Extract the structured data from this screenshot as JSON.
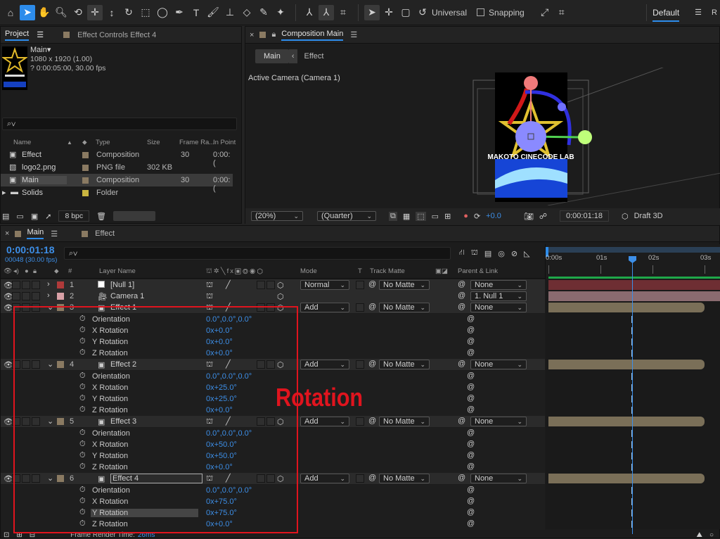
{
  "toolbar": {
    "universal_label": "Universal",
    "snapping_label": "Snapping",
    "workspace": "Default",
    "workspace_more": "R"
  },
  "project": {
    "tab_project": "Project",
    "tab_effect_controls": "Effect Controls Effect 4",
    "comp_name": "Main▾",
    "comp_size": "1080 x 1920 (1.00)",
    "comp_duration": "? 0:00:05:00, 30.00 fps",
    "search_placeholder": "⌕∨",
    "columns": {
      "name": "Name",
      "type": "Type",
      "size": "Size",
      "frame_rate": "Frame Ra...",
      "in_point": "In Point"
    },
    "items": [
      {
        "name": "Effect",
        "type": "Composition",
        "size": "",
        "frame_rate": "30",
        "in_point": "0:00:("
      },
      {
        "name": "logo2.png",
        "type": "PNG file",
        "size": "302 KB",
        "frame_rate": "",
        "in_point": ""
      },
      {
        "name": "Main",
        "type": "Composition",
        "size": "",
        "frame_rate": "30",
        "in_point": "0:00:("
      },
      {
        "name": "Solids",
        "type": "Folder",
        "size": "",
        "frame_rate": "",
        "in_point": ""
      }
    ],
    "bpc": "8 bpc"
  },
  "composition": {
    "tab": "Composition Main",
    "crumb_main": "Main",
    "crumb_effect": "Effect",
    "camera_label": "Active Camera (Camera 1)",
    "logo_text": "MAKOTO CINECODE LAB",
    "zoom": "(20%)",
    "resolution": "(Quarter)",
    "exposure": "+0.0",
    "timecode": "0:00:01:18",
    "renderer": "Draft 3D"
  },
  "timeline": {
    "tab_main": "Main",
    "tab_effect": "Effect",
    "timecode": "0:00:01:18",
    "frame_info": "00048 (30.00 fps)",
    "search_placeholder": "⌕∨",
    "columns": {
      "num": "#",
      "layer_name": "Layer Name",
      "mode": "Mode",
      "t": "T",
      "track_matte": "Track Matte",
      "parent": "Parent & Link"
    },
    "ruler": [
      "0:00s",
      "01s",
      "02s",
      "03s"
    ],
    "render_time": "Frame Render Time:",
    "render_value": "26ms",
    "layers": [
      {
        "num": "1",
        "name": "[Null 1]",
        "mode": "Normal",
        "matte": "No Matte",
        "parent": "None",
        "color": "#b03a3a"
      },
      {
        "num": "2",
        "name": "Camera 1",
        "mode": "",
        "matte": "",
        "parent": "1. Null 1",
        "color": "#d9a1a7"
      },
      {
        "num": "3",
        "name": "Effect 1",
        "mode": "Add",
        "matte": "No Matte",
        "parent": "None",
        "color": "#8a7a62",
        "props": [
          {
            "name": "Orientation",
            "value": "0.0°,0.0°,0.0°"
          },
          {
            "name": "X Rotation",
            "value": "0x+0.0°"
          },
          {
            "name": "Y Rotation",
            "value": "0x+0.0°"
          },
          {
            "name": "Z Rotation",
            "value": "0x+0.0°"
          }
        ]
      },
      {
        "num": "4",
        "name": "Effect 2",
        "mode": "Add",
        "matte": "No Matte",
        "parent": "None",
        "color": "#8a7a62",
        "props": [
          {
            "name": "Orientation",
            "value": "0.0°,0.0°,0.0°"
          },
          {
            "name": "X Rotation",
            "value": "0x+25.0°"
          },
          {
            "name": "Y Rotation",
            "value": "0x+25.0°"
          },
          {
            "name": "Z Rotation",
            "value": "0x+0.0°"
          }
        ]
      },
      {
        "num": "5",
        "name": "Effect 3",
        "mode": "Add",
        "matte": "No Matte",
        "parent": "None",
        "color": "#8a7a62",
        "props": [
          {
            "name": "Orientation",
            "value": "0.0°,0.0°,0.0°"
          },
          {
            "name": "X Rotation",
            "value": "0x+50.0°"
          },
          {
            "name": "Y Rotation",
            "value": "0x+50.0°"
          },
          {
            "name": "Z Rotation",
            "value": "0x+0.0°"
          }
        ]
      },
      {
        "num": "6",
        "name": "Effect 4",
        "mode": "Add",
        "matte": "No Matte",
        "parent": "None",
        "color": "#8a7a62",
        "props": [
          {
            "name": "Orientation",
            "value": "0.0°,0.0°,0.0°"
          },
          {
            "name": "X Rotation",
            "value": "0x+75.0°"
          },
          {
            "name": "Y Rotation",
            "value": "0x+75.0°"
          },
          {
            "name": "Z Rotation",
            "value": "0x+0.0°"
          }
        ]
      }
    ]
  },
  "annotation": {
    "label": "Rotation",
    "color": "#e0141e"
  },
  "colors": {
    "accent": "#2d8ceb",
    "timecode": "#3d8fe8"
  }
}
